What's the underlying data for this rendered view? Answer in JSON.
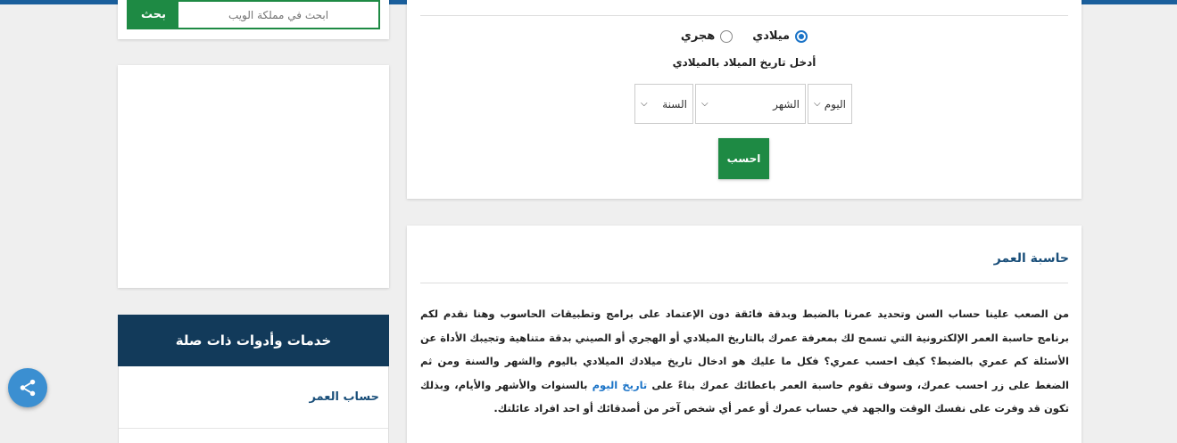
{
  "search": {
    "button_label": "بحث",
    "placeholder": "ابحث في مملكة الويب"
  },
  "form": {
    "calendar_options": [
      {
        "label": "ميلادي",
        "checked": true
      },
      {
        "label": "هجري",
        "checked": false
      }
    ],
    "prompt": "أدخل تاريخ الميلاد بالميلادي",
    "day_select": "اليوم",
    "month_select": "الشهر",
    "year_select": "السنة",
    "calculate_label": "احسب"
  },
  "article": {
    "title": "حاسبة العمر",
    "body_part1": "من الصعب علينا حساب السن وتحديد عمرنا بالضبط وبدقة فائقة دون الإعتماد على برامج وتطبيقات الحاسوب وهنا نقدم لكم برنامج حاسبة العمر الإلكترونية التي تسمح لك بمعرفة عمرك بالتاريخ الميلادي أو الهجري أو الصيني بدقة متناهية وتجيبك الأداة عن الأسئلة كم عمري بالضبط؟ كيف احسب عمري؟ فكل ما عليك هو ادخال تاريخ ميلادك الميلادي باليوم والشهر والسنة ومن ثم الضغط على زر احسب عمرك، وسوف تقوم حاسبة العمر باعطائك عمرك بناءً على ",
    "body_link": "تاريخ اليوم",
    "body_part2": " بالسنوات والأشهر والأيام، وبذلك تكون قد وفرت على نفسك الوقت والجهد في حساب عمرك أو عمر أي شخص آخر من أصدقائك أو احد افراد عائلتك."
  },
  "related": {
    "header": "خدمات وأدوات ذات صلة",
    "items": [
      {
        "label": "حساب العمر"
      }
    ]
  },
  "colors": {
    "accent_green": "#1e8a44",
    "navy": "#123a5a",
    "link_blue": "#1a4f7a",
    "share_blue": "#3b8fd1"
  }
}
